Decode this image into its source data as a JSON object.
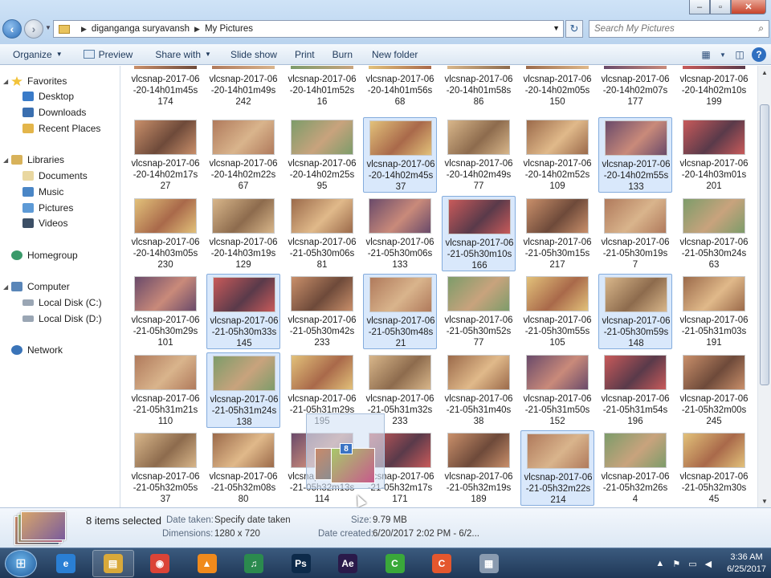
{
  "titlebar": {
    "breadcrumb": [
      "diganganga suryavansh",
      "My Pictures"
    ],
    "search_placeholder": "Search My Pictures",
    "minimize": "–",
    "maximize": "▫",
    "close": "✕"
  },
  "toolbar": {
    "organize": "Organize",
    "preview": "Preview",
    "share_with": "Share with",
    "slide_show": "Slide show",
    "print": "Print",
    "burn": "Burn",
    "new_folder": "New folder"
  },
  "nav": {
    "favorites": "Favorites",
    "desktop": "Desktop",
    "downloads": "Downloads",
    "recent_places": "Recent Places",
    "libraries": "Libraries",
    "documents": "Documents",
    "music": "Music",
    "pictures": "Pictures",
    "videos": "Videos",
    "homegroup": "Homegroup",
    "computer": "Computer",
    "local_c": "Local Disk (C:)",
    "local_d": "Local Disk (D:)",
    "network": "Network"
  },
  "top_partial": [
    {
      "l1": "vlcsnap-2017-06",
      "l2": "-20-14h01m45s",
      "l3": "174"
    },
    {
      "l1": "vlcsnap-2017-06",
      "l2": "-20-14h01m49s",
      "l3": "242"
    },
    {
      "l1": "vlcsnap-2017-06",
      "l2": "-20-14h01m52s",
      "l3": "16"
    },
    {
      "l1": "vlcsnap-2017-06",
      "l2": "-20-14h01m56s",
      "l3": "68"
    },
    {
      "l1": "vlcsnap-2017-06",
      "l2": "-20-14h01m58s",
      "l3": "86"
    },
    {
      "l1": "vlcsnap-2017-06",
      "l2": "-20-14h02m05s",
      "l3": "150"
    },
    {
      "l1": "vlcsnap-2017-06",
      "l2": "-20-14h02m07s",
      "l3": "177"
    },
    {
      "l1": "vlcsnap-2017-06",
      "l2": "-20-14h02m10s",
      "l3": "199"
    }
  ],
  "rows": [
    [
      {
        "l1": "vlcsnap-2017-06",
        "l2": "-20-14h02m17s",
        "l3": "27",
        "sel": false
      },
      {
        "l1": "vlcsnap-2017-06",
        "l2": "-20-14h02m22s",
        "l3": "67",
        "sel": false
      },
      {
        "l1": "vlcsnap-2017-06",
        "l2": "-20-14h02m25s",
        "l3": "95",
        "sel": false
      },
      {
        "l1": "vlcsnap-2017-06",
        "l2": "-20-14h02m45s",
        "l3": "37",
        "sel": true
      },
      {
        "l1": "vlcsnap-2017-06",
        "l2": "-20-14h02m49s",
        "l3": "77",
        "sel": false
      },
      {
        "l1": "vlcsnap-2017-06",
        "l2": "-20-14h02m52s",
        "l3": "109",
        "sel": false
      },
      {
        "l1": "vlcsnap-2017-06",
        "l2": "-20-14h02m55s",
        "l3": "133",
        "sel": true
      },
      {
        "l1": "vlcsnap-2017-06",
        "l2": "-20-14h03m01s",
        "l3": "201",
        "sel": false
      }
    ],
    [
      {
        "l1": "vlcsnap-2017-06",
        "l2": "-20-14h03m05s",
        "l3": "230",
        "sel": false
      },
      {
        "l1": "vlcsnap-2017-06",
        "l2": "-20-14h03m19s",
        "l3": "129",
        "sel": false
      },
      {
        "l1": "vlcsnap-2017-06",
        "l2": "-21-05h30m06s",
        "l3": "81",
        "sel": false
      },
      {
        "l1": "vlcsnap-2017-06",
        "l2": "-21-05h30m06s",
        "l3": "133",
        "sel": false
      },
      {
        "l1": "vlcsnap-2017-06",
        "l2": "-21-05h30m10s",
        "l3": "166",
        "sel": true
      },
      {
        "l1": "vlcsnap-2017-06",
        "l2": "-21-05h30m15s",
        "l3": "217",
        "sel": false
      },
      {
        "l1": "vlcsnap-2017-06",
        "l2": "-21-05h30m19s",
        "l3": "7",
        "sel": false
      },
      {
        "l1": "vlcsnap-2017-06",
        "l2": "-21-05h30m24s",
        "l3": "63",
        "sel": false
      }
    ],
    [
      {
        "l1": "vlcsnap-2017-06",
        "l2": "-21-05h30m29s",
        "l3": "101",
        "sel": false
      },
      {
        "l1": "vlcsnap-2017-06",
        "l2": "-21-05h30m33s",
        "l3": "145",
        "sel": true
      },
      {
        "l1": "vlcsnap-2017-06",
        "l2": "-21-05h30m42s",
        "l3": "233",
        "sel": false
      },
      {
        "l1": "vlcsnap-2017-06",
        "l2": "-21-05h30m48s",
        "l3": "21",
        "sel": true
      },
      {
        "l1": "vlcsnap-2017-06",
        "l2": "-21-05h30m52s",
        "l3": "77",
        "sel": false
      },
      {
        "l1": "vlcsnap-2017-06",
        "l2": "-21-05h30m55s",
        "l3": "105",
        "sel": false
      },
      {
        "l1": "vlcsnap-2017-06",
        "l2": "-21-05h30m59s",
        "l3": "148",
        "sel": true
      },
      {
        "l1": "vlcsnap-2017-06",
        "l2": "-21-05h31m03s",
        "l3": "191",
        "sel": false
      }
    ],
    [
      {
        "l1": "vlcsnap-2017-06",
        "l2": "-21-05h31m21s",
        "l3": "110",
        "sel": false
      },
      {
        "l1": "vlcsnap-2017-06",
        "l2": "-21-05h31m24s",
        "l3": "138",
        "sel": true
      },
      {
        "l1": "vlcsnap-2017-06",
        "l2": "-21-05h31m29s",
        "l3": "195",
        "sel": false
      },
      {
        "l1": "vlcsnap-2017-06",
        "l2": "-21-05h31m32s",
        "l3": "233",
        "sel": false
      },
      {
        "l1": "vlcsnap-2017-06",
        "l2": "-21-05h31m40s",
        "l3": "38",
        "sel": false
      },
      {
        "l1": "vlcsnap-2017-06",
        "l2": "-21-05h31m50s",
        "l3": "152",
        "sel": false
      },
      {
        "l1": "vlcsnap-2017-06",
        "l2": "-21-05h31m54s",
        "l3": "196",
        "sel": false
      },
      {
        "l1": "vlcsnap-2017-06",
        "l2": "-21-05h32m00s",
        "l3": "245",
        "sel": false
      }
    ],
    [
      {
        "l1": "vlcsnap-2017-06",
        "l2": "-21-05h32m05s",
        "l3": "37",
        "sel": false
      },
      {
        "l1": "vlcsnap-2017-06",
        "l2": "-21-05h32m08s",
        "l3": "80",
        "sel": false
      },
      {
        "l1": "vlcsnap-2017-06",
        "l2": "-21-05h32m13s",
        "l3": "114",
        "sel": false
      },
      {
        "l1": "vlcsnap-2017-06",
        "l2": "-21-05h32m17s",
        "l3": "171",
        "sel": false
      },
      {
        "l1": "vlcsnap-2017-06",
        "l2": "-21-05h32m19s",
        "l3": "189",
        "sel": false
      },
      {
        "l1": "vlcsnap-2017-06",
        "l2": "-21-05h32m22s",
        "l3": "214",
        "sel": true
      },
      {
        "l1": "vlcsnap-2017-06",
        "l2": "-21-05h32m26s",
        "l3": "4",
        "sel": false
      },
      {
        "l1": "vlcsnap-2017-06",
        "l2": "-21-05h32m30s",
        "l3": "45",
        "sel": false
      }
    ]
  ],
  "drag": {
    "count": "8"
  },
  "details": {
    "selected": "8 items selected",
    "date_taken_label": "Date taken:",
    "date_taken": "Specify date taken",
    "dimensions_label": "Dimensions:",
    "dimensions": "1280 x 720",
    "size_label": "Size:",
    "size": "9.79 MB",
    "date_created_label": "Date created:",
    "date_created": "6/20/2017 2:02 PM - 6/2..."
  },
  "taskbar": {
    "time": "3:36 AM",
    "date": "6/25/2017",
    "apps": [
      {
        "name": "ie-icon",
        "glyph": "e",
        "color": "#2a7fd4"
      },
      {
        "name": "explorer-icon",
        "glyph": "▤",
        "color": "#d9a93a"
      },
      {
        "name": "chrome-icon",
        "glyph": "◉",
        "color": "#db4437"
      },
      {
        "name": "vlc-icon",
        "glyph": "▲",
        "color": "#f08a1c"
      },
      {
        "name": "audio-icon",
        "glyph": "♫",
        "color": "#2b8a4e"
      },
      {
        "name": "photoshop-icon",
        "glyph": "Ps",
        "color": "#0d2a4a"
      },
      {
        "name": "aftereffects-icon",
        "glyph": "Ae",
        "color": "#2a1a4a"
      },
      {
        "name": "camtasia-green-icon",
        "glyph": "C",
        "color": "#3aa83a"
      },
      {
        "name": "camtasia-orange-icon",
        "glyph": "C",
        "color": "#e4572e"
      },
      {
        "name": "calculator-icon",
        "glyph": "▦",
        "color": "#8a9bb0"
      }
    ]
  }
}
